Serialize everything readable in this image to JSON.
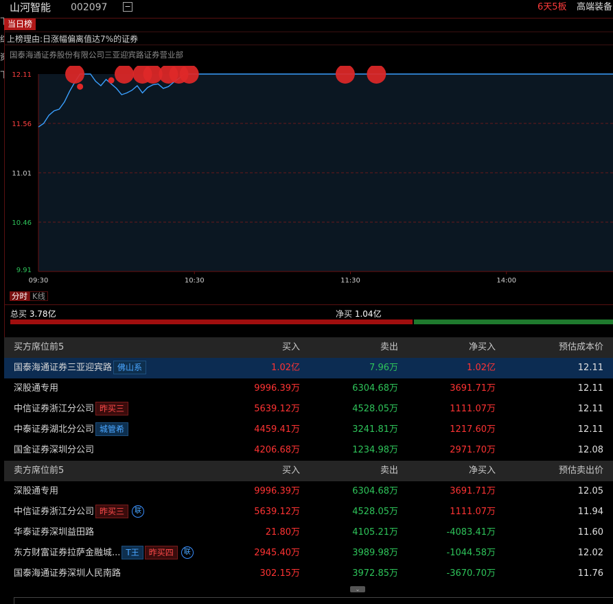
{
  "header": {
    "stock_name": "山河智能",
    "stock_code": "002097",
    "collapse_symbol": "−",
    "streak": "6天5板",
    "sector": "高端装备"
  },
  "left_edge": [
    "下",
    "综",
    "资",
    "下"
  ],
  "panel": {
    "tab_today": "当日榜",
    "reason": "上榜理由:日涨幅偏离值达7%的证券",
    "broker": "国泰海通证券股份有限公司三亚迎宾路证券营业部"
  },
  "chart_data": {
    "type": "line",
    "y_ticks": [
      "12.11",
      "11.56",
      "11.01",
      "10.46",
      "9.91"
    ],
    "x_ticks": [
      "09:30",
      "10:30",
      "11:30",
      "14:00"
    ],
    "ylim": [
      9.91,
      12.11
    ],
    "x": [
      "09:30",
      "09:32",
      "09:34",
      "09:36",
      "09:38",
      "09:40",
      "09:42",
      "09:44",
      "09:46",
      "09:48",
      "09:50",
      "09:52",
      "09:54",
      "09:56",
      "09:58",
      "10:00",
      "10:02",
      "10:04",
      "10:06",
      "10:08",
      "10:10",
      "10:12",
      "10:14",
      "10:16",
      "10:18",
      "10:20",
      "10:22",
      "10:24",
      "10:26",
      "10:28",
      "10:30",
      "10:40",
      "10:50",
      "11:00",
      "11:10",
      "11:20",
      "11:30",
      "13:10",
      "13:20",
      "13:30",
      "13:40",
      "13:50",
      "14:00",
      "14:10",
      "14:20",
      "14:30",
      "14:40",
      "14:50",
      "15:00"
    ],
    "series": [
      {
        "values": [
          11.52,
          11.56,
          11.65,
          11.7,
          11.72,
          11.8,
          11.92,
          12.02,
          12.11,
          12.11,
          12.11,
          12.03,
          11.98,
          12.05,
          12.0,
          11.95,
          11.88,
          11.9,
          11.93,
          11.98,
          11.9,
          11.96,
          11.99,
          12.0,
          11.95,
          11.97,
          12.02,
          12.06,
          12.11,
          12.11,
          12.11,
          12.11,
          12.11,
          12.11,
          12.11,
          12.11,
          12.11,
          12.11,
          12.11,
          12.11,
          12.11,
          12.11,
          12.11,
          12.11,
          12.11,
          12.11,
          12.11,
          12.11,
          12.11
        ]
      }
    ],
    "markers": [
      {
        "x": "09:44",
        "y": 12.11,
        "size": "large"
      },
      {
        "x": "09:46",
        "y": 11.97,
        "size": "small"
      },
      {
        "x": "10:10",
        "y": 12.11,
        "size": "large"
      },
      {
        "x": "10:14",
        "y": 12.11,
        "size": "large"
      },
      {
        "x": "10:20",
        "y": 12.11,
        "size": "large"
      },
      {
        "x": "10:24",
        "y": 12.11,
        "size": "large"
      },
      {
        "x": "10:28",
        "y": 12.11,
        "size": "large"
      },
      {
        "x": "11:28",
        "y": 12.11,
        "size": "large"
      },
      {
        "x": "11:33",
        "y": 12.11,
        "size": "large"
      },
      {
        "x": "13:10",
        "y": 12.11,
        "size": "large"
      },
      {
        "x": "09:58",
        "y": 12.04,
        "size": "small"
      }
    ],
    "colors": {
      "line": "#3aa0ff",
      "marker": "#e02828",
      "up": "#ff4040",
      "down": "#2ec45a",
      "mid": "#cccccc"
    }
  },
  "chart_tabs": [
    "分时",
    "K线"
  ],
  "summary": {
    "total_buy_label": "总买",
    "total_buy_value": "3.78亿",
    "net_buy_label": "净买",
    "net_buy_value": "1.04亿",
    "buy_share": 0.67
  },
  "buy_table": {
    "headers": [
      "买方席位前5",
      "买入",
      "卖出",
      "净买入",
      "预估成本价"
    ],
    "rows": [
      {
        "name": "国泰海通证券三亚迎宾路",
        "tag": "佛山系",
        "tag_type": "blue",
        "buy": "1.02亿",
        "sell": "7.96万",
        "net": "1.02亿",
        "price": "12.11"
      },
      {
        "name": "深股通专用",
        "buy": "9996.39万",
        "sell": "6304.68万",
        "net": "3691.71万",
        "price": "12.11"
      },
      {
        "name": "中信证券浙江分公司",
        "tag": "昨买三",
        "tag_type": "red",
        "buy": "5639.12万",
        "sell": "4528.05万",
        "net": "1111.07万",
        "price": "12.11"
      },
      {
        "name": "中泰证券湖北分公司",
        "tag": "城管希",
        "tag_type": "blue",
        "buy": "4459.41万",
        "sell": "3241.81万",
        "net": "1217.60万",
        "price": "12.11"
      },
      {
        "name": "国金证券深圳分公司",
        "buy": "4206.68万",
        "sell": "1234.98万",
        "net": "2971.70万",
        "price": "12.08"
      }
    ]
  },
  "sell_table": {
    "headers": [
      "卖方席位前5",
      "买入",
      "卖出",
      "净买入",
      "预估卖出价"
    ],
    "rows": [
      {
        "name": "深股通专用",
        "buy": "9996.39万",
        "sell": "6304.68万",
        "net": "3691.71万",
        "net_sign": "pos",
        "price": "12.05"
      },
      {
        "name": "中信证券浙江分公司",
        "tag": "昨买三",
        "tag_type": "red",
        "lian": "联",
        "buy": "5639.12万",
        "sell": "4528.05万",
        "net": "1111.07万",
        "net_sign": "pos",
        "price": "11.94"
      },
      {
        "name": "华泰证券深圳益田路",
        "buy": "21.80万",
        "sell": "4105.21万",
        "net": "-4083.41万",
        "net_sign": "neg",
        "price": "11.60"
      },
      {
        "name": "东方财富证券拉萨金融城...",
        "tag": "T王",
        "tag_type": "blue",
        "tag2": "昨买四",
        "tag2_type": "red",
        "lian": "联",
        "buy": "2945.40万",
        "sell": "3989.98万",
        "net": "-1044.58万",
        "net_sign": "neg",
        "price": "12.02"
      },
      {
        "name": "国泰海通证券深圳人民南路",
        "buy": "302.15万",
        "sell": "3972.85万",
        "net": "-3670.70万",
        "net_sign": "neg",
        "price": "11.76"
      }
    ]
  },
  "scroll_symbol": "⌄"
}
